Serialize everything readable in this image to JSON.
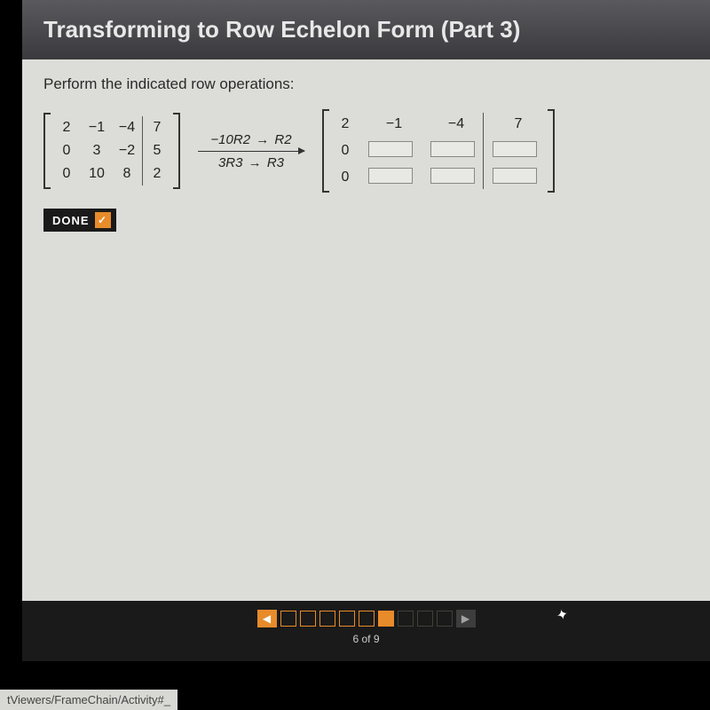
{
  "title": "Transforming to Row Echelon Form (Part 3)",
  "instruction": "Perform the indicated row operations:",
  "source_matrix": {
    "rows": [
      [
        "2",
        "−1",
        "−4",
        "7"
      ],
      [
        "0",
        "3",
        "−2",
        "5"
      ],
      [
        "0",
        "10",
        "8",
        "2"
      ]
    ]
  },
  "operations": {
    "op1_lhs": "−10R2",
    "op1_rhs": "R2",
    "op2_lhs": "3R3",
    "op2_rhs": "R3",
    "arrow": "→"
  },
  "result_matrix": {
    "row0": [
      "2",
      "−1",
      "−4",
      "7"
    ],
    "row1_first": "0",
    "row2_first": "0"
  },
  "done_label": "DONE",
  "check_glyph": "✓",
  "nav": {
    "prev_glyph": "◀",
    "next_glyph": "▶",
    "boxes": [
      {
        "filled": false,
        "dim": false
      },
      {
        "filled": false,
        "dim": false
      },
      {
        "filled": false,
        "dim": false
      },
      {
        "filled": false,
        "dim": false
      },
      {
        "filled": false,
        "dim": false
      },
      {
        "filled": true,
        "dim": false
      },
      {
        "filled": false,
        "dim": true
      },
      {
        "filled": false,
        "dim": true
      },
      {
        "filled": false,
        "dim": true
      }
    ],
    "position_text": "6 of 9"
  },
  "status_text": "tViewers/FrameChain/Activity#_",
  "cursor_glyph": "↖"
}
